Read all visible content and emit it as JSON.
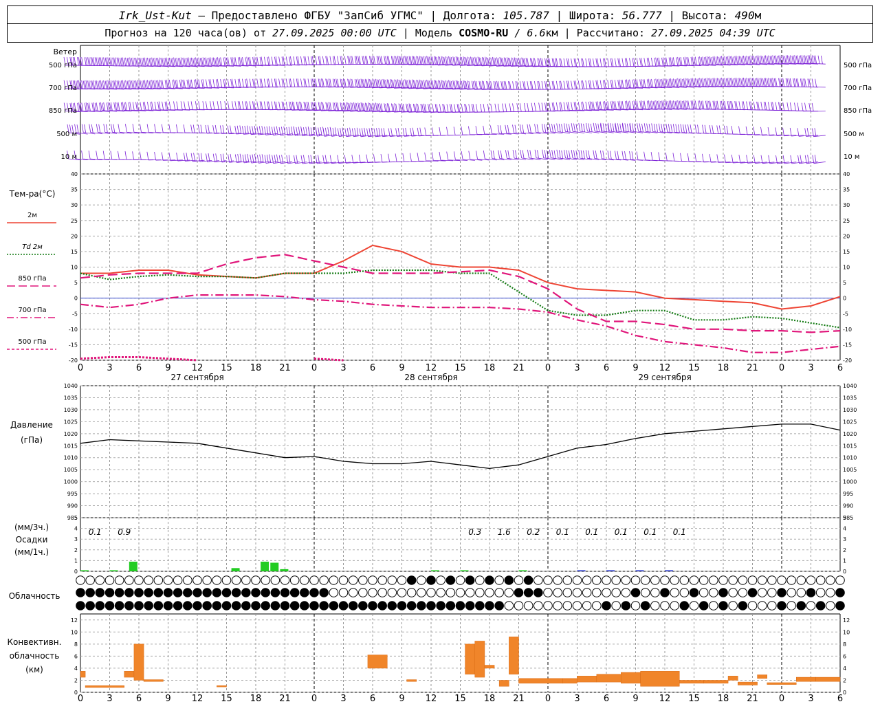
{
  "header": {
    "station": "Irk_Ust-Kut",
    "provider": " – Предоставлено ФГБУ \"ЗапСиб УГМС\" | Долгота: ",
    "lon": "105.787",
    "lat_label": " | Широта: ",
    "lat": "56.777",
    "alt_label": " | Высота: ",
    "alt": "490",
    "alt_unit": "м",
    "forecast_label": "Прогноз на 120 часа(ов) от ",
    "forecast_from": "27.09.2025 00:00 UTC",
    "model_label": "  | Модель ",
    "model": "COSMO-RU",
    "res": " / 6.6",
    "res_unit": "км",
    "calc_label": " | Рассчитано: ",
    "calc": "27.09.2025 04:39 UTC"
  },
  "wind": {
    "title": "Ветер",
    "levels": [
      "500 гПа",
      "700 гПа",
      "850 гПа",
      "500 м",
      "10 м"
    ],
    "color": "#7b1fd6"
  },
  "temp": {
    "title": "Тем-ра(°С)",
    "legend": [
      {
        "label": "2м",
        "color": "#ee4433",
        "style": "solid"
      },
      {
        "label": "Td  2м",
        "color": "#127a12",
        "style": "dotted"
      },
      {
        "label": "850 гПа",
        "color": "#e0157a",
        "style": "long-dash"
      },
      {
        "label": "700 гПа",
        "color": "#e0157a",
        "style": "dash-dot"
      },
      {
        "label": "500 гПа",
        "color": "#e0157a",
        "style": "short-dash"
      }
    ]
  },
  "pressure": {
    "title1": "Давление",
    "title2": "(гПа)"
  },
  "precip": {
    "title1": "(мм/3ч.)",
    "title2": "Осадки",
    "title3": "(мм/1ч.)"
  },
  "cloud": {
    "title": "Облачность"
  },
  "conv": {
    "title1": "Конвективн.",
    "title2": "облачность",
    "title3": "(км)"
  },
  "x_tick_labels": [
    "0",
    "3",
    "6",
    "9",
    "12",
    "15",
    "18",
    "21",
    "0",
    "3",
    "6",
    "9",
    "12",
    "15",
    "18",
    "21",
    "0",
    "3",
    "6",
    "9",
    "12",
    "15",
    "18",
    "21",
    "0",
    "3",
    "6"
  ],
  "day_labels": [
    "27 сентября",
    "28 сентября",
    "29 сентября"
  ],
  "chart_data": [
    {
      "type": "line",
      "title": "Тем-ра(°С)",
      "x_hours": [
        0,
        3,
        6,
        9,
        12,
        15,
        18,
        21,
        24,
        27,
        30,
        33,
        36,
        39,
        42,
        45,
        48,
        51,
        54,
        57,
        60,
        63,
        66,
        69,
        72,
        75,
        78
      ],
      "ylim": [
        -20,
        40
      ],
      "yticks": [
        -20,
        -15,
        -10,
        -5,
        0,
        5,
        10,
        15,
        20,
        25,
        30,
        35,
        40
      ],
      "series": [
        {
          "name": "2м",
          "values": [
            8,
            8,
            9,
            9,
            7.5,
            7,
            6.5,
            8,
            8,
            12,
            17,
            15,
            11,
            10,
            10,
            9,
            5,
            3,
            2.5,
            2,
            0,
            -0.5,
            -1,
            -1.5,
            -3.5,
            -2.5,
            0.5
          ]
        },
        {
          "name": "Td  2м",
          "values": [
            8,
            6,
            7,
            7.5,
            7,
            7,
            6.5,
            8,
            8,
            8,
            9,
            9,
            9,
            8,
            8,
            2,
            -4,
            -5.5,
            -5.5,
            -4,
            -4,
            -7,
            -7,
            -6,
            -6.5,
            -8,
            -9.5
          ]
        },
        {
          "name": "850 гПа",
          "values": [
            6.5,
            7.5,
            8,
            8,
            8,
            11,
            13,
            14,
            12,
            10,
            8,
            8,
            8,
            8.5,
            9,
            7,
            3,
            -3.5,
            -7.5,
            -7.5,
            -8.5,
            -10,
            -10,
            -10.5,
            -10.5,
            -11,
            -10.5
          ]
        },
        {
          "name": "700 гПа",
          "values": [
            -2,
            -3,
            -2,
            0,
            1,
            1,
            1,
            0.5,
            -0.5,
            -1,
            -2,
            -2.5,
            -3,
            -3,
            -3,
            -3.5,
            -4.5,
            -7,
            -9,
            -12,
            -14,
            -15,
            -16,
            -17.5,
            -17.5,
            -16.5,
            -15.5
          ]
        },
        {
          "name": "500 гПа",
          "values": [
            -19.5,
            -19,
            -19,
            -19.5,
            -20,
            null,
            null,
            null,
            -19.5,
            -20,
            null,
            -19.5,
            null,
            null,
            null,
            null,
            null,
            null,
            null,
            null,
            null,
            null,
            null,
            null,
            null,
            null,
            null
          ]
        }
      ]
    },
    {
      "type": "line",
      "title": "Давление",
      "x_hours": [
        0,
        3,
        6,
        9,
        12,
        15,
        18,
        21,
        24,
        27,
        30,
        33,
        36,
        39,
        42,
        45,
        48,
        51,
        54,
        57,
        60,
        63,
        66,
        69,
        72,
        75,
        78
      ],
      "ylim": [
        985,
        1040
      ],
      "yticks": [
        985,
        990,
        995,
        1000,
        1005,
        1010,
        1015,
        1020,
        1025,
        1030,
        1035,
        1040
      ],
      "series": [
        {
          "name": "Давление",
          "values": [
            1016,
            1017.5,
            1017,
            1016.5,
            1016,
            1014,
            1012,
            1010,
            1010.5,
            1008.5,
            1007.5,
            1007.5,
            1008.5,
            1007,
            1005.5,
            1007,
            1010.5,
            1014,
            1015.5,
            1018,
            1020,
            1021,
            1022,
            1023,
            1024,
            1024,
            1021.5
          ]
        }
      ]
    },
    {
      "type": "bar",
      "title": "Осадки",
      "ylim": [
        0,
        5
      ],
      "yticks": [
        0,
        1,
        2,
        3,
        4,
        5
      ],
      "x_hours": [
        0,
        3,
        5,
        15.5,
        18.5,
        19.5,
        20.5,
        36,
        39,
        45,
        51,
        54,
        57,
        60
      ],
      "values": [
        0.1,
        0.1,
        0.9,
        0.3,
        0.9,
        0.8,
        0.2,
        0.1,
        0.1,
        0.1,
        0.1,
        0.1,
        0.1,
        0.1
      ],
      "labels": [
        {
          "hour": 1.5,
          "text": "0.1"
        },
        {
          "hour": 4.5,
          "text": "0.9"
        },
        {
          "hour": 40.5,
          "text": "0.3"
        },
        {
          "hour": 43.5,
          "text": "1.6"
        },
        {
          "hour": 46.5,
          "text": "0.2"
        },
        {
          "hour": 49.5,
          "text": "0.1"
        },
        {
          "hour": 52.5,
          "text": "0.1"
        },
        {
          "hour": 55.5,
          "text": "0.1"
        },
        {
          "hour": 58.5,
          "text": "0.1"
        },
        {
          "hour": 61.5,
          "text": "0.1"
        }
      ]
    },
    {
      "type": "bar",
      "title": "Конвективн. облачность",
      "ylim": [
        0,
        13
      ],
      "yticks": [
        0,
        2,
        4,
        6,
        8,
        10,
        12
      ],
      "bars": [
        {
          "h0": 0,
          "h1": 0.5,
          "bottom": 2.5,
          "top": 3.5
        },
        {
          "h0": 0.5,
          "h1": 4.5,
          "bottom": 0.8,
          "top": 1.1
        },
        {
          "h0": 4.5,
          "h1": 5.5,
          "bottom": 2.5,
          "top": 3.5
        },
        {
          "h0": 5.5,
          "h1": 6.5,
          "bottom": 2,
          "top": 8
        },
        {
          "h0": 6.5,
          "h1": 8.5,
          "bottom": 1.8,
          "top": 2.1
        },
        {
          "h0": 14,
          "h1": 15,
          "bottom": 0.9,
          "top": 1.1
        },
        {
          "h0": 29.5,
          "h1": 31.5,
          "bottom": 4,
          "top": 6.2
        },
        {
          "h0": 33.5,
          "h1": 34.5,
          "bottom": 1.8,
          "top": 2.1
        },
        {
          "h0": 39.5,
          "h1": 40.5,
          "bottom": 3,
          "top": 8
        },
        {
          "h0": 40.5,
          "h1": 41.5,
          "bottom": 2.5,
          "top": 8.5
        },
        {
          "h0": 41.5,
          "h1": 42.5,
          "bottom": 4,
          "top": 4.5
        },
        {
          "h0": 43,
          "h1": 44,
          "bottom": 1,
          "top": 2
        },
        {
          "h0": 44,
          "h1": 45,
          "bottom": 3,
          "top": 9.2
        },
        {
          "h0": 45,
          "h1": 49.5,
          "bottom": 1.5,
          "top": 2.3
        },
        {
          "h0": 49.5,
          "h1": 51,
          "bottom": 1.5,
          "top": 2.3
        },
        {
          "h0": 51,
          "h1": 53,
          "bottom": 1.7,
          "top": 2.7
        },
        {
          "h0": 53,
          "h1": 55.5,
          "bottom": 1.7,
          "top": 3
        },
        {
          "h0": 55.5,
          "h1": 57.5,
          "bottom": 1.5,
          "top": 3.3
        },
        {
          "h0": 57.5,
          "h1": 61.5,
          "bottom": 1,
          "top": 3.5
        },
        {
          "h0": 61.5,
          "h1": 64,
          "bottom": 1.5,
          "top": 2
        },
        {
          "h0": 64,
          "h1": 66.5,
          "bottom": 1.5,
          "top": 2
        },
        {
          "h0": 66.5,
          "h1": 67.5,
          "bottom": 2,
          "top": 2.7
        },
        {
          "h0": 67.5,
          "h1": 69.5,
          "bottom": 1.2,
          "top": 1.7
        },
        {
          "h0": 69.5,
          "h1": 70.5,
          "bottom": 2.3,
          "top": 2.9
        },
        {
          "h0": 70.5,
          "h1": 73.5,
          "bottom": 1.3,
          "top": 1.6
        },
        {
          "h0": 73.5,
          "h1": 75.5,
          "bottom": 1.8,
          "top": 2.5
        },
        {
          "h0": 75.5,
          "h1": 78,
          "bottom": 1.8,
          "top": 2.5
        }
      ]
    }
  ]
}
